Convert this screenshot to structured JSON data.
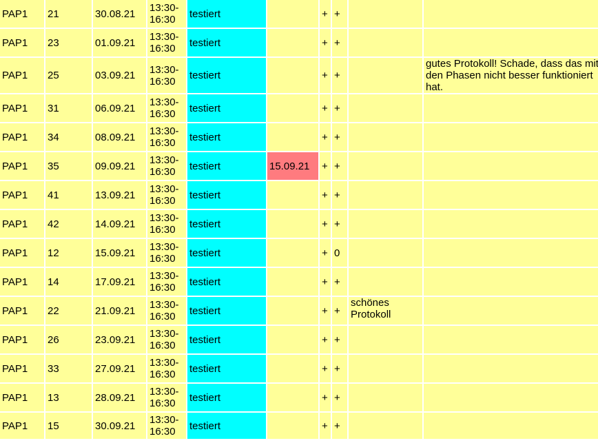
{
  "rows": [
    {
      "course": "PAP1",
      "no": "21",
      "date": "30.08.21",
      "time": "13:30-\n16:30",
      "status": "testiert",
      "extra_date": "",
      "mark1": "+",
      "mark2": "+",
      "comment1": "",
      "comment2": ""
    },
    {
      "course": "PAP1",
      "no": "23",
      "date": "01.09.21",
      "time": "13:30-\n16:30",
      "status": "testiert",
      "extra_date": "",
      "mark1": "+",
      "mark2": "+",
      "comment1": "",
      "comment2": ""
    },
    {
      "course": "PAP1",
      "no": "25",
      "date": "03.09.21",
      "time": "13:30-\n16:30",
      "status": "testiert",
      "extra_date": "",
      "mark1": "+",
      "mark2": "+",
      "comment1": "",
      "comment2": "gutes Protokoll! Schade, dass das mit den Phasen nicht besser funktioniert hat."
    },
    {
      "course": "PAP1",
      "no": "31",
      "date": "06.09.21",
      "time": "13:30-\n16:30",
      "status": "testiert",
      "extra_date": "",
      "mark1": "+",
      "mark2": "+",
      "comment1": "",
      "comment2": ""
    },
    {
      "course": "PAP1",
      "no": "34",
      "date": "08.09.21",
      "time": "13:30-\n16:30",
      "status": "testiert",
      "extra_date": "",
      "mark1": "+",
      "mark2": "+",
      "comment1": "",
      "comment2": ""
    },
    {
      "course": "PAP1",
      "no": "35",
      "date": "09.09.21",
      "time": "13:30-\n16:30",
      "status": "testiert",
      "extra_date": "15.09.21",
      "mark1": "+",
      "mark2": "+",
      "comment1": "",
      "comment2": ""
    },
    {
      "course": "PAP1",
      "no": "41",
      "date": "13.09.21",
      "time": "13:30-\n16:30",
      "status": "testiert",
      "extra_date": "",
      "mark1": "+",
      "mark2": "+",
      "comment1": "",
      "comment2": ""
    },
    {
      "course": "PAP1",
      "no": "42",
      "date": "14.09.21",
      "time": "13:30-\n16:30",
      "status": "testiert",
      "extra_date": "",
      "mark1": "+",
      "mark2": "+",
      "comment1": "",
      "comment2": ""
    },
    {
      "course": "PAP1",
      "no": "12",
      "date": "15.09.21",
      "time": "13:30-\n16:30",
      "status": "testiert",
      "extra_date": "",
      "mark1": "+",
      "mark2": "0",
      "comment1": "",
      "comment2": ""
    },
    {
      "course": "PAP1",
      "no": "14",
      "date": "17.09.21",
      "time": "13:30-\n16:30",
      "status": "testiert",
      "extra_date": "",
      "mark1": "+",
      "mark2": "+",
      "comment1": "",
      "comment2": ""
    },
    {
      "course": "PAP1",
      "no": "22",
      "date": "21.09.21",
      "time": "13:30-\n16:30",
      "status": "testiert",
      "extra_date": "",
      "mark1": "+",
      "mark2": "+",
      "comment1": "schönes Protokoll",
      "comment2": ""
    },
    {
      "course": "PAP1",
      "no": "26",
      "date": "23.09.21",
      "time": "13:30-\n16:30",
      "status": "testiert",
      "extra_date": "",
      "mark1": "+",
      "mark2": "+",
      "comment1": "",
      "comment2": ""
    },
    {
      "course": "PAP1",
      "no": "33",
      "date": "27.09.21",
      "time": "13:30-\n16:30",
      "status": "testiert",
      "extra_date": "",
      "mark1": "+",
      "mark2": "+",
      "comment1": "",
      "comment2": ""
    },
    {
      "course": "PAP1",
      "no": "13",
      "date": "28.09.21",
      "time": "13:30-\n16:30",
      "status": "testiert",
      "extra_date": "",
      "mark1": "+",
      "mark2": "+",
      "comment1": "",
      "comment2": ""
    },
    {
      "course": "PAP1",
      "no": "15",
      "date": "30.09.21",
      "time": "13:30-\n16:30",
      "status": "testiert",
      "extra_date": "",
      "mark1": "+",
      "mark2": "+",
      "comment1": "",
      "comment2": ""
    }
  ],
  "colors": {
    "cell_bg": "#ffff99",
    "status_bg": "#00ffff",
    "alert_bg": "#ff7b7f",
    "grid": "#ffffff"
  }
}
